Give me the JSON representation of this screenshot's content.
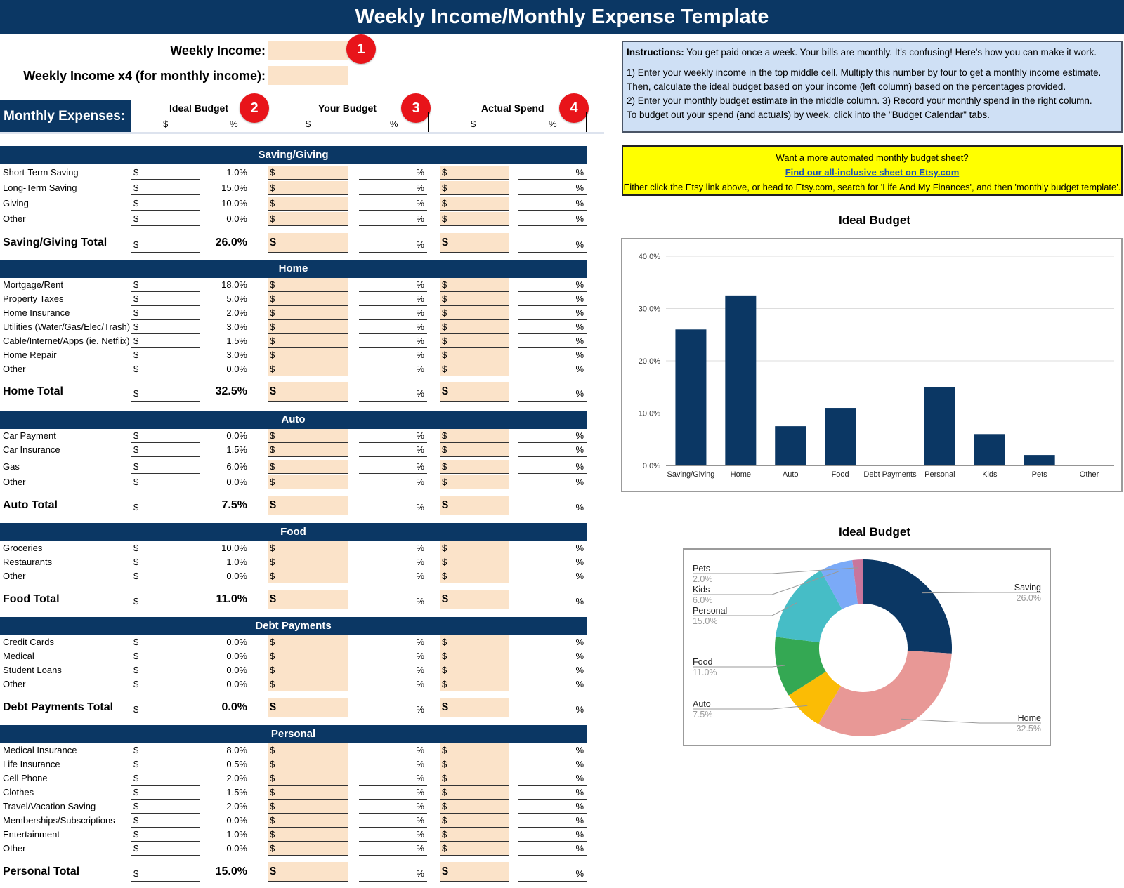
{
  "header": {
    "title": "Weekly Income/Monthly Expense Template"
  },
  "income": {
    "weekly_label": "Weekly Income:",
    "weekly_value": "",
    "monthly_label": "Weekly Income x4 (for monthly income):",
    "monthly_value": ""
  },
  "badges": [
    "1",
    "2",
    "3",
    "4"
  ],
  "columns": {
    "monthly_expenses_label": "Monthly Expenses:",
    "ideal": "Ideal Budget",
    "your": "Your Budget",
    "actual": "Actual Spend",
    "dollar": "$",
    "pct": "%"
  },
  "instructions": {
    "bold": "Instructions:",
    "line1": " You get paid once a week. Your bills are monthly. It's confusing! Here's how you can make it work.",
    "line2": "1) Enter your weekly income in the top middle cell. Multiply this number by four to get a monthly income estimate.",
    "line3": "Then, calculate the ideal budget based on your income (left column) based on the percentages provided.",
    "line4": "2) Enter your monthly budget estimate in the middle column. 3) Record your monthly spend in the right column.",
    "line5": "To budget out your spend (and actuals) by week, click into the \"Budget Calendar\" tabs."
  },
  "promo": {
    "line1": "Want a more automated monthly budget sheet?",
    "link": "Find our all-inclusive sheet on Etsy.com",
    "line3": "Either click the Etsy link above, or head to Etsy.com, search for 'Life And My Finances', and then 'monthly budget template'."
  },
  "sections": [
    {
      "title": "Saving/Giving",
      "rows": [
        {
          "name": "Short-Term Saving",
          "pct": "1.0%"
        },
        {
          "name": "Long-Term Saving",
          "pct": "15.0%"
        },
        {
          "name": "Giving",
          "pct": "10.0%"
        },
        {
          "name": "Other",
          "pct": "0.0%"
        }
      ],
      "total": {
        "name": "Saving/Giving Total",
        "pct": "26.0%"
      }
    },
    {
      "title": "Home",
      "rows": [
        {
          "name": "Mortgage/Rent",
          "pct": "18.0%"
        },
        {
          "name": "Property Taxes",
          "pct": "5.0%"
        },
        {
          "name": "Home Insurance",
          "pct": "2.0%"
        },
        {
          "name": "Utilities (Water/Gas/Elec/Trash)",
          "pct": "3.0%"
        },
        {
          "name": "Cable/Internet/Apps (ie. Netflix)",
          "pct": "1.5%"
        },
        {
          "name": "Home Repair",
          "pct": "3.0%"
        },
        {
          "name": "Other",
          "pct": "0.0%"
        }
      ],
      "total": {
        "name": "Home Total",
        "pct": "32.5%"
      }
    },
    {
      "title": "Auto",
      "rows": [
        {
          "name": "Car Payment",
          "pct": "0.0%"
        },
        {
          "name": "Car Insurance",
          "pct": "1.5%"
        },
        {
          "name": "Gas",
          "pct": "6.0%"
        },
        {
          "name": "Other",
          "pct": "0.0%"
        }
      ],
      "total": {
        "name": "Auto Total",
        "pct": "7.5%"
      }
    },
    {
      "title": "Food",
      "rows": [
        {
          "name": "Groceries",
          "pct": "10.0%"
        },
        {
          "name": "Restaurants",
          "pct": "1.0%"
        },
        {
          "name": "Other",
          "pct": "0.0%"
        }
      ],
      "total": {
        "name": "Food Total",
        "pct": "11.0%"
      }
    },
    {
      "title": "Debt Payments",
      "rows": [
        {
          "name": "Credit Cards",
          "pct": "0.0%"
        },
        {
          "name": "Medical",
          "pct": "0.0%"
        },
        {
          "name": "Student Loans",
          "pct": "0.0%"
        },
        {
          "name": "Other",
          "pct": "0.0%"
        }
      ],
      "total": {
        "name": "Debt Payments Total",
        "pct": "0.0%"
      }
    },
    {
      "title": "Personal",
      "rows": [
        {
          "name": "Medical Insurance",
          "pct": "8.0%"
        },
        {
          "name": "Life Insurance",
          "pct": "0.5%"
        },
        {
          "name": "Cell Phone",
          "pct": "2.0%"
        },
        {
          "name": "Clothes",
          "pct": "1.5%"
        },
        {
          "name": "Travel/Vacation Saving",
          "pct": "2.0%"
        },
        {
          "name": "Memberships/Subscriptions",
          "pct": "0.0%"
        },
        {
          "name": "Entertainment",
          "pct": "1.0%"
        },
        {
          "name": "Other",
          "pct": "0.0%"
        }
      ],
      "total": {
        "name": "Personal Total",
        "pct": "15.0%"
      }
    }
  ],
  "chart_data": [
    {
      "type": "bar",
      "title": "Ideal Budget",
      "categories": [
        "Saving/Giving",
        "Home",
        "Auto",
        "Food",
        "Debt Payments",
        "Personal",
        "Kids",
        "Pets",
        "Other"
      ],
      "values": [
        26.0,
        32.5,
        7.5,
        11.0,
        0.0,
        15.0,
        6.0,
        2.0,
        0.0
      ],
      "yticks": [
        "0.0%",
        "10.0%",
        "20.0%",
        "30.0%",
        "40.0%"
      ],
      "ylim": [
        0,
        40
      ],
      "xlabel": "",
      "ylabel": "",
      "grid": true,
      "color": "#0b3764"
    },
    {
      "type": "pie",
      "title": "Ideal Budget",
      "donut": true,
      "slices": [
        {
          "label": "Saving",
          "value": 26.0,
          "display": "26.0%",
          "color": "#0b3764"
        },
        {
          "label": "Home",
          "value": 32.5,
          "display": "32.5%",
          "color": "#e89896"
        },
        {
          "label": "Auto",
          "value": 7.5,
          "display": "7.5%",
          "color": "#fbbc05"
        },
        {
          "label": "Food",
          "value": 11.0,
          "display": "11.0%",
          "color": "#34a853"
        },
        {
          "label": "Personal",
          "value": 15.0,
          "display": "15.0%",
          "color": "#46bdc6"
        },
        {
          "label": "Kids",
          "value": 6.0,
          "display": "6.0%",
          "color": "#7baaf7"
        },
        {
          "label": "Pets",
          "value": 2.0,
          "display": "2.0%",
          "color": "#c9759c"
        }
      ]
    }
  ]
}
